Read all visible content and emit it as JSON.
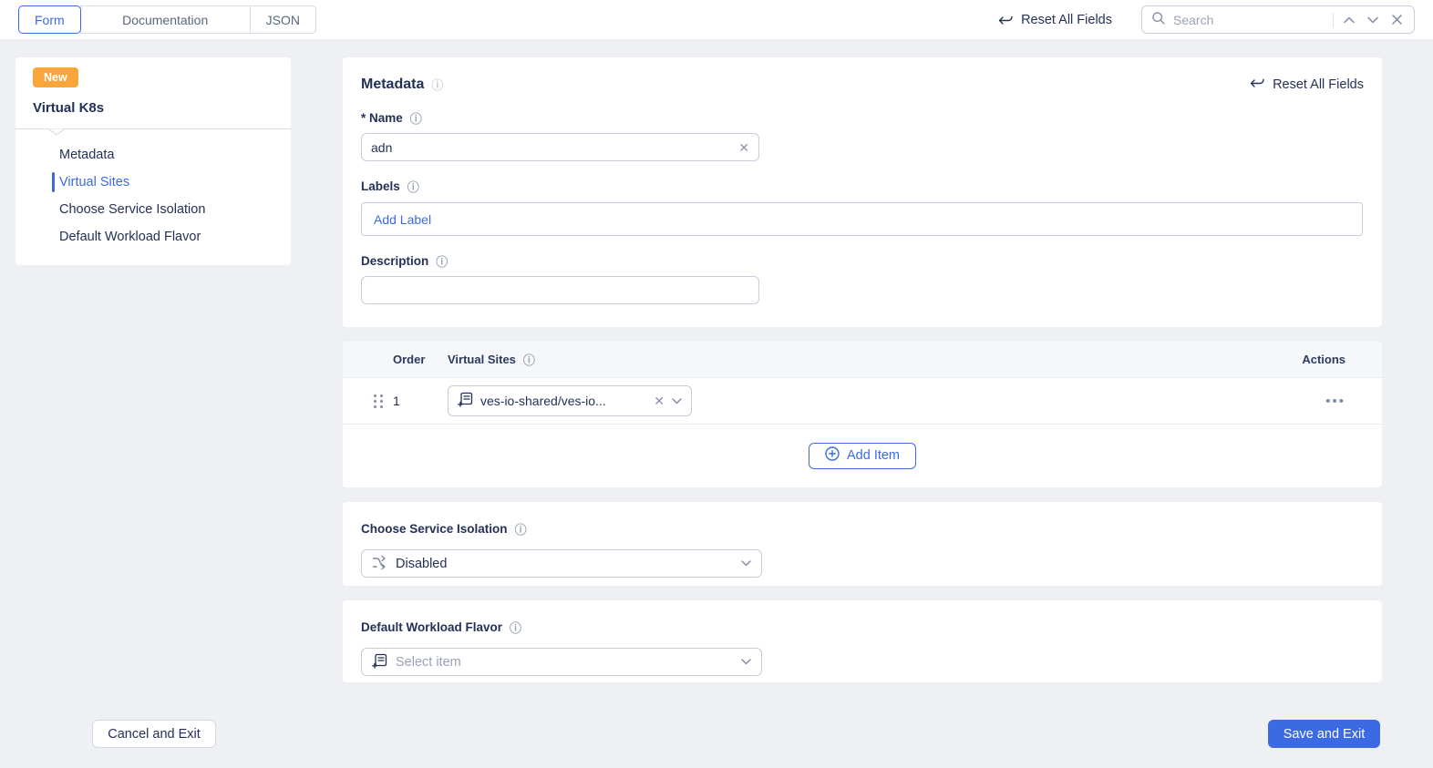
{
  "topbar": {
    "tabs": [
      {
        "label": "Form"
      },
      {
        "label": "Documentation"
      },
      {
        "label": "JSON"
      }
    ],
    "reset_all_label": "Reset All Fields",
    "search": {
      "placeholder": "Search"
    }
  },
  "sidebar": {
    "badge": "New",
    "title": "Virtual K8s",
    "items": [
      {
        "label": "Metadata"
      },
      {
        "label": "Virtual Sites"
      },
      {
        "label": "Choose Service Isolation"
      },
      {
        "label": "Default Workload Flavor"
      }
    ]
  },
  "metadata": {
    "title": "Metadata",
    "reset_all_label": "Reset All Fields",
    "name": {
      "label": "* Name",
      "value": "adn"
    },
    "labels": {
      "label": "Labels",
      "add_label": "Add Label"
    },
    "description": {
      "label": "Description",
      "value": ""
    }
  },
  "virtual_sites_table": {
    "columns": {
      "order": "Order",
      "sites": "Virtual Sites",
      "actions": "Actions"
    },
    "rows": [
      {
        "order": "1",
        "site_ref": "ves-io-shared/ves-io..."
      }
    ],
    "add_item_label": "Add Item"
  },
  "service_isolation": {
    "label": "Choose Service Isolation",
    "value": "Disabled"
  },
  "workload_flavor": {
    "label": "Default Workload Flavor",
    "placeholder": "Select item"
  },
  "footer": {
    "cancel_label": "Cancel and Exit",
    "save_label": "Save and Exit"
  },
  "icons": {
    "info": "ⓘ",
    "clear": "✕",
    "ellipsis": "•••"
  },
  "colors": {
    "accent_blue": "#3b6ae3",
    "badge_orange": "#f8a63a",
    "text_navy": "#243157",
    "muted_gray": "#8c96ab",
    "page_background": "#eef0f4"
  }
}
